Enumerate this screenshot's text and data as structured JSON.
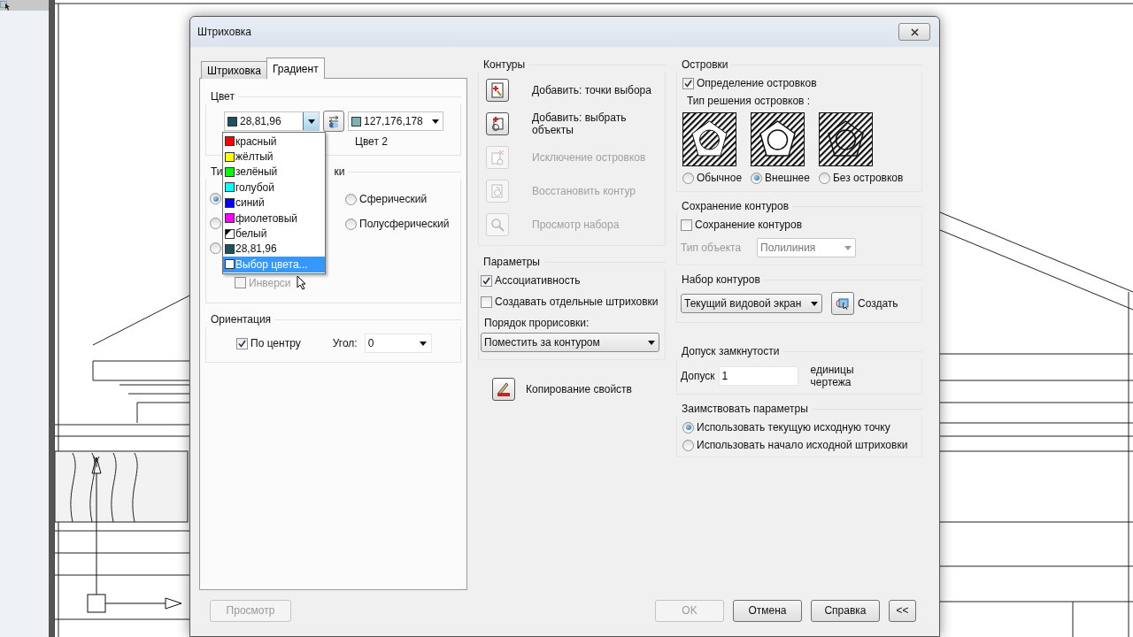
{
  "window": {
    "title": "Штриховка"
  },
  "tabs": [
    {
      "label": "Штриховка",
      "selected": false
    },
    {
      "label": "Градиент",
      "selected": true
    }
  ],
  "color_group": {
    "title": "Цвет",
    "color1": {
      "value": "28,81,96",
      "color": "#1c5160"
    },
    "color2": {
      "value": "127,176,178",
      "color": "#7fb0b2",
      "label": "Цвет 2"
    }
  },
  "color_menu": [
    {
      "label": "красный",
      "kind": "solid",
      "color": "#ff0000",
      "selected": false
    },
    {
      "label": "жёлтый",
      "kind": "solid",
      "color": "#ffff00",
      "selected": false
    },
    {
      "label": "зелёный",
      "kind": "solid",
      "color": "#00ff00",
      "selected": false
    },
    {
      "label": "голубой",
      "kind": "solid",
      "color": "#00ffff",
      "selected": false
    },
    {
      "label": "синий",
      "kind": "solid",
      "color": "#0000ff",
      "selected": false
    },
    {
      "label": "фиолетовый",
      "kind": "solid",
      "color": "#ff00ff",
      "selected": false
    },
    {
      "label": "белый",
      "kind": "split",
      "color": "#ffffff",
      "selected": false
    },
    {
      "label": "28,81,96",
      "kind": "solid",
      "color": "#1c5160",
      "selected": false
    },
    {
      "label": "Выбор цвета...",
      "kind": "solid",
      "color": "#ffffff",
      "selected": true
    }
  ],
  "gradient_type": {
    "title_parts": [
      "Ти",
      "ки"
    ],
    "patterns": [
      {
        "selected": true
      },
      {
        "selected": false
      },
      {
        "selected": false
      }
    ],
    "options": [
      {
        "label": "Сферический",
        "selected": false
      },
      {
        "label": "Полусферический",
        "selected": false
      }
    ],
    "invert": {
      "label": "Инверси",
      "checked": false,
      "disabled": true
    }
  },
  "orientation": {
    "title": "Ориентация",
    "centered": {
      "label": "По центру",
      "checked": true
    },
    "angle_label": "Угол:",
    "angle": "0"
  },
  "contours": {
    "title": "Контуры",
    "actions": [
      {
        "kind": "pick",
        "label": "Добавить: точки выбора",
        "disabled": false
      },
      {
        "kind": "select",
        "label": "Добавить: выбрать объекты",
        "disabled": false
      },
      {
        "kind": "remove",
        "label": "Исключение островков",
        "disabled": true
      },
      {
        "kind": "recreate",
        "label": "Восстановить контур",
        "disabled": true
      },
      {
        "kind": "view",
        "label": "Просмотр набора",
        "disabled": true
      }
    ]
  },
  "parameters": {
    "title": "Параметры",
    "options": [
      {
        "label": "Ассоциативность",
        "checked": true
      },
      {
        "label": "Создавать отдельные штриховки",
        "checked": false
      }
    ],
    "draw_order_label": "Порядок прорисовки:",
    "draw_order": "Поместить за контуром"
  },
  "copy_properties": "Копирование свойств",
  "islands": {
    "title": "Островки",
    "detect": {
      "label": "Определение островков",
      "checked": true
    },
    "style_label": "Тип решения островков :",
    "styles": [
      {
        "kind": "normal",
        "label": "Обычное",
        "selected": false
      },
      {
        "kind": "outer",
        "label": "Внешнее",
        "selected": true
      },
      {
        "kind": "ignore",
        "label": "Без островков",
        "selected": false
      }
    ]
  },
  "retain": {
    "title": "Сохранение контуров",
    "checkbox": {
      "label": "Сохранение контуров",
      "checked": false
    },
    "type_label": "Тип объекта",
    "type_value": "Полилиния",
    "disabled": true
  },
  "boundary_set": {
    "title": "Набор контуров",
    "value": "Текущий видовой экран",
    "button": "Создать"
  },
  "gap": {
    "title": "Допуск замкнутости",
    "label": "Допуск",
    "value": "1",
    "units": "единицы чертежа"
  },
  "inherit": {
    "title": "Заимствовать параметры",
    "options": [
      {
        "label": "Использовать текущую исходную точку",
        "selected": true
      },
      {
        "label": "Использовать начало исходной штриховки",
        "selected": false
      }
    ]
  },
  "preview_button": {
    "label": "Просмотр",
    "disabled": true
  },
  "buttons": [
    {
      "label": "OK",
      "disabled": true
    },
    {
      "label": "Отмена",
      "disabled": false
    },
    {
      "label": "Справка",
      "disabled": false
    },
    {
      "label": "<<",
      "disabled": false
    }
  ]
}
